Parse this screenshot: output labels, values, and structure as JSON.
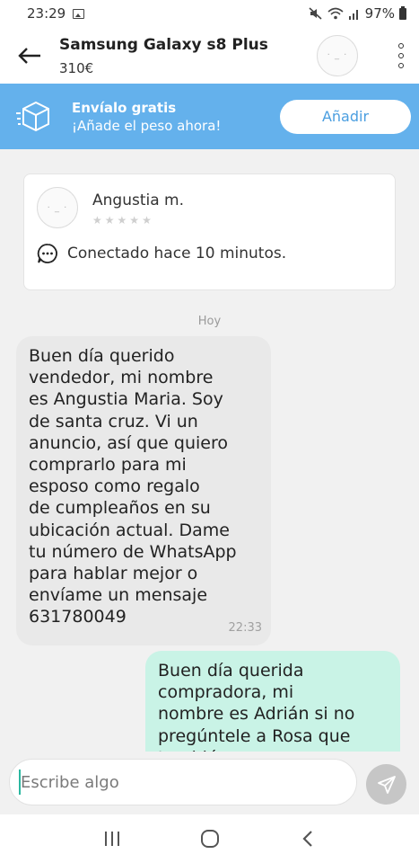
{
  "status_bar": {
    "time": "23:29",
    "battery": "97%",
    "icons": [
      "gallery-icon",
      "mute-icon",
      "wifi-icon",
      "signal-icon",
      "battery-icon"
    ]
  },
  "header": {
    "back_icon": "arrow-left-icon",
    "title": "Samsung Galaxy s8 Plus",
    "price": "310€",
    "more_icon": "more-vertical-icon"
  },
  "shipping_banner": {
    "title": "Envíalo gratis",
    "subtitle": "¡Añade el peso ahora!",
    "button_label": "Añadir",
    "icon": "package-box-icon",
    "color": "#64b1ec"
  },
  "seller": {
    "name": "Angustia m.",
    "rating_stars": 5,
    "rating_value": 0,
    "status": "Conectado hace 10 minutos.",
    "status_icon": "chat-bubble-icon"
  },
  "conversation": {
    "day_label": "Hoy",
    "messages": [
      {
        "direction": "incoming",
        "text": "Buen día querido\nvendedor, mi nombre\nes Angustia Maria. Soy\nde santa cruz. Vi un\nanuncio, así que quiero\ncomprarlo para mi\nesposo como regalo\nde cumpleaños en su\nubicación actual. Dame\ntu número de WhatsApp\npara hablar mejor o\nenvíame un mensaje\n631780049",
        "time": "22:33"
      },
      {
        "direction": "outgoing",
        "text": "Buen día querida\ncompradora, mi\nnombre es Adrián si no\npregúntele a Rosa que\ntambién"
      }
    ]
  },
  "composer": {
    "placeholder": "Escribe algo",
    "send_icon": "send-icon"
  },
  "nav_bar": {
    "icons": [
      "recent-apps-icon",
      "home-icon",
      "back-icon"
    ]
  },
  "colors": {
    "incoming_bubble": "#e9e9e9",
    "outgoing_bubble": "#c9f3e6",
    "accent": "#2bb7a0"
  }
}
